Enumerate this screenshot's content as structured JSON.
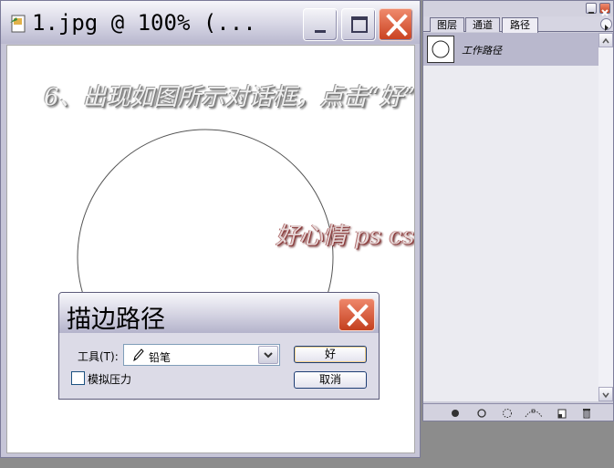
{
  "document": {
    "title": "1.jpg @ 100% (...",
    "caption": "6、出现如图所示对话框，点击“好”；",
    "brand": "好心情 ps cs 教程"
  },
  "dialog": {
    "title": "描边路径",
    "tool_label": "工具(T):",
    "tool_value": "铅笔",
    "simulate_pressure_label": "模拟压力",
    "simulate_pressure_checked": false,
    "ok_label": "好",
    "cancel_label": "取消"
  },
  "palette": {
    "tabs": [
      {
        "label": "图层",
        "active": false
      },
      {
        "label": "通道",
        "active": false
      },
      {
        "label": "路径",
        "active": true
      }
    ],
    "paths": [
      {
        "name": "工作路径",
        "selected": true
      }
    ],
    "bottom_icons": [
      "fill-path-icon",
      "stroke-path-icon",
      "load-selection-icon",
      "make-work-path-icon",
      "new-path-icon",
      "trash-icon"
    ]
  },
  "colors": {
    "close_red": "#c9401f",
    "titlebar": "#dcdbe8",
    "selected_row": "#b9b8cd",
    "brand_red": "#8b3a3a"
  }
}
